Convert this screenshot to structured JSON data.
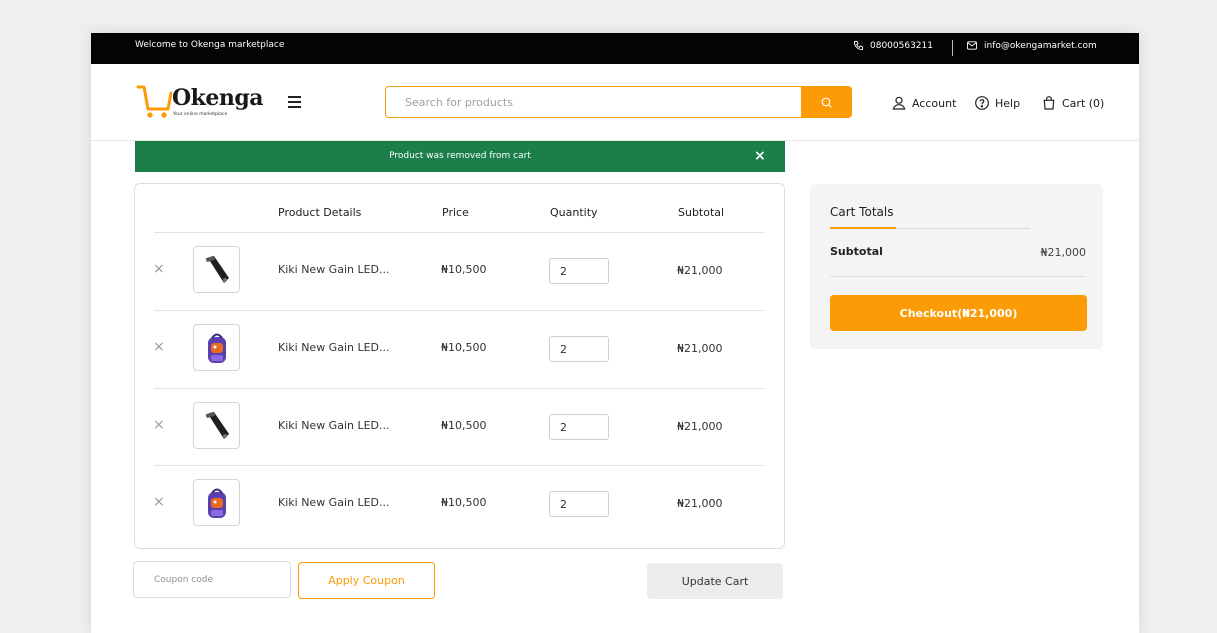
{
  "topbar": {
    "welcome": "Welcome to Okenga marketplace",
    "phone": "08000563211",
    "email": "info@okengamarket.com"
  },
  "header": {
    "brand": "Okenga",
    "tagline": "Your online marketplace",
    "search_placeholder": "Search for products",
    "account": "Account",
    "help": "Help",
    "cart": "Cart (0)"
  },
  "alert": {
    "message": "Product was removed from cart",
    "close": "×"
  },
  "cart_table": {
    "headers": {
      "product": "Product Details",
      "price": "Price",
      "quantity": "Quantity",
      "subtotal": "Subtotal"
    },
    "rows": [
      {
        "name": "Kiki New Gain LED...",
        "price": "₦10,500",
        "qty": "2",
        "subtotal": "₦21,000",
        "image": "hair-clipper"
      },
      {
        "name": "Kiki New Gain LED...",
        "price": "₦10,500",
        "qty": "2",
        "subtotal": "₦21,000",
        "image": "backpack"
      },
      {
        "name": "Kiki New Gain LED...",
        "price": "₦10,500",
        "qty": "2",
        "subtotal": "₦21,000",
        "image": "hair-clipper"
      },
      {
        "name": "Kiki New Gain LED...",
        "price": "₦10,500",
        "qty": "2",
        "subtotal": "₦21,000",
        "image": "backpack"
      }
    ],
    "remove_symbol": "×"
  },
  "actions": {
    "coupon_placeholder": "Coupon code",
    "apply_coupon": "Apply Coupon",
    "update_cart": "Update Cart"
  },
  "totals": {
    "title": "Cart Totals",
    "subtotal_label": "Subtotal",
    "subtotal_value": "₦21,000",
    "checkout": "Checkout(₦21,000)"
  },
  "colors": {
    "accent": "#fb9b05",
    "success": "#1c7f4a",
    "topbar": "#040404"
  }
}
